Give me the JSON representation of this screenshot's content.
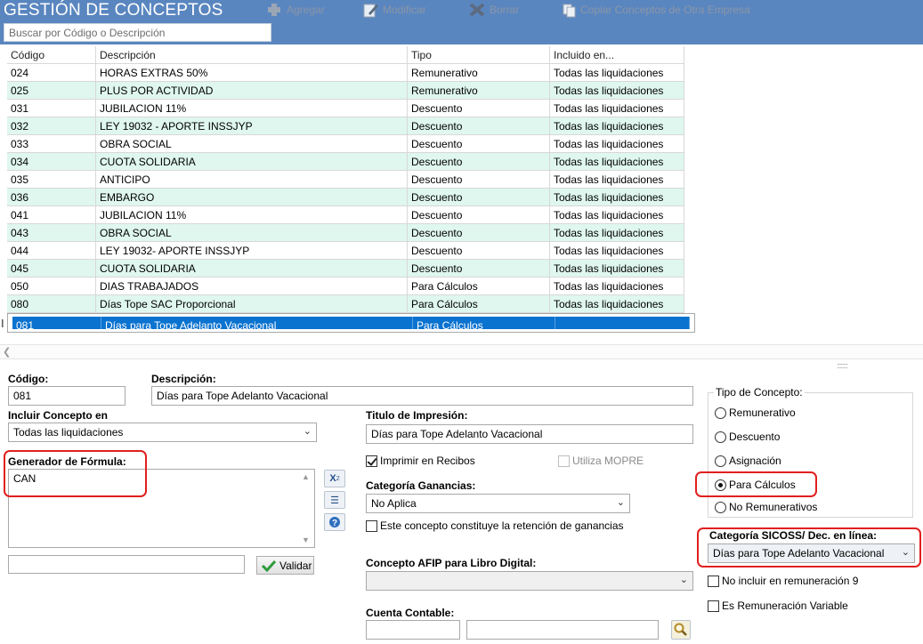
{
  "header": {
    "title": "GESTIÓN DE CONCEPTOS",
    "toolbar": {
      "agregar": "Agregar",
      "modificar": "Modificar",
      "borrar": "Borrar",
      "copiar": "Copiar Conceptos de Otra Empresa"
    },
    "search_placeholder": "Buscar por Código o Descripción"
  },
  "grid": {
    "columns": [
      "Código",
      "Descripción",
      "Tipo",
      "Incluido en..."
    ],
    "rows": [
      [
        "024",
        "HORAS EXTRAS 50%",
        "Remunerativo",
        "Todas las liquidaciones"
      ],
      [
        "025",
        "PLUS POR ACTIVIDAD",
        "Remunerativo",
        "Todas las liquidaciones"
      ],
      [
        "031",
        "JUBILACION 11%",
        "Descuento",
        "Todas las liquidaciones"
      ],
      [
        "032",
        "LEY 19032 - APORTE INSSJYP",
        "Descuento",
        "Todas las liquidaciones"
      ],
      [
        "033",
        "OBRA SOCIAL",
        "Descuento",
        "Todas las liquidaciones"
      ],
      [
        "034",
        "CUOTA SOLIDARIA",
        "Descuento",
        "Todas las liquidaciones"
      ],
      [
        "035",
        "ANTICIPO",
        "Descuento",
        "Todas las liquidaciones"
      ],
      [
        "036",
        "EMBARGO",
        "Descuento",
        "Todas las liquidaciones"
      ],
      [
        "041",
        "JUBILACION 11%",
        "Descuento",
        "Todas las liquidaciones"
      ],
      [
        "043",
        "OBRA SOCIAL",
        "Descuento",
        "Todas las liquidaciones"
      ],
      [
        "044",
        "LEY 19032- APORTE INSSJYP",
        "Descuento",
        "Todas las liquidaciones"
      ],
      [
        "045",
        "CUOTA SOLIDARIA",
        "Descuento",
        "Todas las liquidaciones"
      ],
      [
        "050",
        "DIAS TRABAJADOS",
        "Para Cálculos",
        "Todas las liquidaciones"
      ],
      [
        "080",
        "Días Tope SAC Proporcional",
        "Para Cálculos",
        "Todas las liquidaciones"
      ],
      [
        "081",
        "Días para Tope Adelanto Vacacional",
        "Para Cálculos",
        ""
      ]
    ],
    "selected_index": 14
  },
  "form": {
    "codigo_label": "Código:",
    "codigo_value": "081",
    "descripcion_label": "Descripción:",
    "descripcion_value": "Días para Tope Adelanto Vacacional",
    "incluir_label": "Incluir Concepto en",
    "incluir_value": "Todas las liquidaciones",
    "titulo_label": "Titulo de Impresión:",
    "titulo_value": "Días para Tope Adelanto Vacacional",
    "formula_label": "Generador de Fórmula:",
    "formula_value": "CAN",
    "validar_label": "Validar",
    "imprimir_label": "Imprimir en Recibos",
    "mopre_label": "Utiliza MOPRE",
    "ganancias_label": "Categoría Ganancias:",
    "ganancias_value": "No Aplica",
    "retencion_label": "Este concepto constituye la retención de ganancias",
    "afip_label": "Concepto AFIP para Libro Digital:",
    "afip_value": "",
    "cuenta_label": "Cuenta Contable:",
    "tipo_group_label": "Tipo de Concepto:",
    "tipo_options": [
      "Remunerativo",
      "Descuento",
      "Asignación",
      "Para Cálculos",
      "No Remunerativos"
    ],
    "tipo_selected": "Para Cálculos",
    "sicoss_label": "Categoría SICOSS/ Dec. en línea:",
    "sicoss_value": "Días para Tope Adelanto Vacacional",
    "no_incluir_label": "No incluir en remuneración 9",
    "variable_label": "Es Remuneración Variable"
  },
  "colors": {
    "header_bg": "#5a86c0",
    "row_alt": "#dff7ee",
    "row_selected": "#0a72cf",
    "highlight": "#e0201e"
  }
}
